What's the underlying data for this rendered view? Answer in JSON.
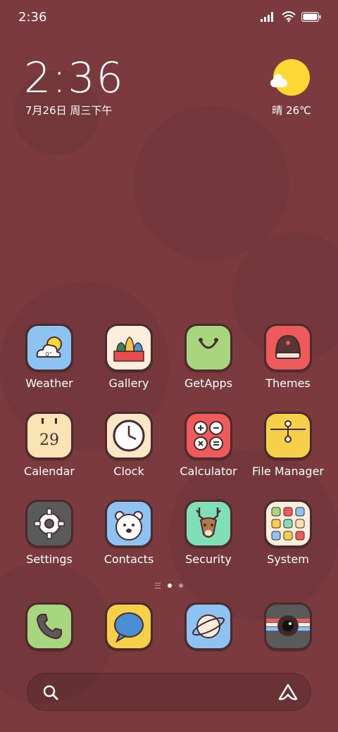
{
  "status_bar": {
    "time": "2:36"
  },
  "clock_widget": {
    "time": "2:36",
    "date": "7月26日 周三下午"
  },
  "weather_widget": {
    "text": "晴 26℃",
    "icon": "sun-cloud-icon"
  },
  "apps": [
    {
      "label": "Weather",
      "icon": "weather-icon",
      "sub": "0°"
    },
    {
      "label": "Gallery",
      "icon": "gallery-icon"
    },
    {
      "label": "GetApps",
      "icon": "getapps-icon"
    },
    {
      "label": "Themes",
      "icon": "themes-icon"
    },
    {
      "label": "Calendar",
      "icon": "calendar-icon",
      "sub": "29"
    },
    {
      "label": "Clock",
      "icon": "clock-icon"
    },
    {
      "label": "Calculator",
      "icon": "calculator-icon"
    },
    {
      "label": "File Manager",
      "icon": "file-manager-icon"
    },
    {
      "label": "Settings",
      "icon": "settings-icon"
    },
    {
      "label": "Contacts",
      "icon": "contacts-icon"
    },
    {
      "label": "Security",
      "icon": "security-icon"
    },
    {
      "label": "System",
      "icon": "system-folder-icon"
    }
  ],
  "dock": [
    {
      "icon": "phone-icon"
    },
    {
      "icon": "messages-icon"
    },
    {
      "icon": "browser-icon"
    },
    {
      "icon": "camera-icon"
    }
  ],
  "page_indicator": {
    "current_page": 1,
    "total_pages": 2
  },
  "search_bar": {
    "left_icon": "search-icon",
    "right_icon": "assistant-icon"
  },
  "colors": {
    "wallpaper": "#7a3a3e",
    "icon_outline": "#4a2a2c"
  }
}
